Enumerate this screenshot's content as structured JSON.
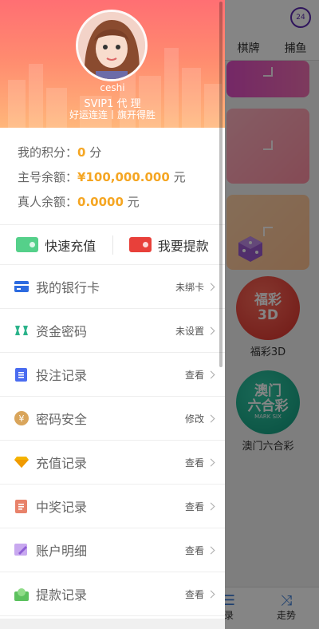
{
  "background": {
    "support_icon_text": "24",
    "tabs": [
      "棋牌",
      "捕鱼"
    ],
    "games": [
      {
        "logo_line1": "福彩",
        "logo_line2": "3D",
        "name": "福彩3D"
      },
      {
        "logo_line1": "澳门",
        "logo_line2": "六合彩",
        "logo_line3": "MARK SIX",
        "name": "澳门六合彩"
      }
    ],
    "bottom_nav": [
      {
        "icon": "list-icon",
        "label": "录"
      },
      {
        "icon": "shuffle-icon",
        "label": "走势"
      }
    ]
  },
  "profile": {
    "username": "ceshi",
    "level": "SVIP1 代 理",
    "slogan": "好运连连丨旗开得胜"
  },
  "balances": [
    {
      "label": "我的积分：",
      "value": "0",
      "unit": " 分"
    },
    {
      "label": "主号余额：",
      "value": "¥100,000.000",
      "unit": " 元"
    },
    {
      "label": "真人余额：",
      "value": "0.0000",
      "unit": " 元"
    }
  ],
  "actions": {
    "recharge": "快速充值",
    "withdraw": "我要提款"
  },
  "menu": [
    {
      "icon": "bank-card-icon",
      "color": "#2d6be0",
      "label": "我的银行卡",
      "status": "未绑卡"
    },
    {
      "icon": "fund-password-icon",
      "color": "#2bb38a",
      "label": "资金密码",
      "status": "未设置"
    },
    {
      "icon": "bet-record-icon",
      "color": "#4a6cf0",
      "label": "投注记录",
      "status": "查看"
    },
    {
      "icon": "security-icon",
      "color": "#d9a55b",
      "label": "密码安全",
      "status": "修改"
    },
    {
      "icon": "diamond-icon",
      "color": "#f5b300",
      "label": "充值记录",
      "status": "查看"
    },
    {
      "icon": "prize-record-icon",
      "color": "#e8826a",
      "label": "中奖记录",
      "status": "查看"
    },
    {
      "icon": "account-detail-icon",
      "color": "#b48ae0",
      "label": "账户明细",
      "status": "查看"
    },
    {
      "icon": "withdraw-record-icon",
      "color": "#5cc15e",
      "label": "提款记录",
      "status": "查看"
    }
  ]
}
